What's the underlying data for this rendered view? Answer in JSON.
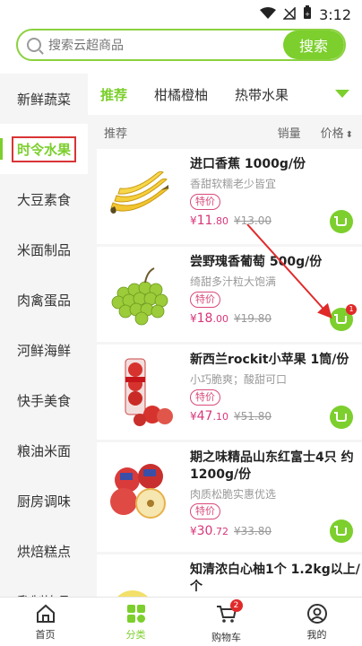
{
  "status_bar": {
    "time": "3:12"
  },
  "search": {
    "placeholder": "搜索云超商品",
    "button_label": "搜索"
  },
  "sidebar": {
    "items": [
      {
        "label": "新鲜蔬菜",
        "active": false
      },
      {
        "label": "时令水果",
        "active": true
      },
      {
        "label": "大豆素食",
        "active": false
      },
      {
        "label": "米面制品",
        "active": false
      },
      {
        "label": "肉禽蛋品",
        "active": false
      },
      {
        "label": "河鲜海鲜",
        "active": false
      },
      {
        "label": "快手美食",
        "active": false
      },
      {
        "label": "粮油米面",
        "active": false
      },
      {
        "label": "厨房调味",
        "active": false
      },
      {
        "label": "烘焙糕点",
        "active": false
      },
      {
        "label": "乳制饮品",
        "active": false
      }
    ]
  },
  "tabs": {
    "items": [
      "推荐",
      "柑橘橙柚",
      "热带水果"
    ],
    "active_index": 0
  },
  "sort": {
    "recommend": "推荐",
    "sales": "销量",
    "price": "价格",
    "price_arrows": "⬍"
  },
  "products": [
    {
      "name": "进口香蕉 1000g/份",
      "desc": "香甜软糯老少皆宜",
      "badge": "特价",
      "currency": "¥",
      "price_int": "11",
      "price_dec": ".80",
      "old_price": "¥13.00",
      "cart_count": ""
    },
    {
      "name": "尝野瑰香葡萄 500g/份",
      "desc": "绮甜多汁粒大饱满",
      "badge": "特价",
      "currency": "¥",
      "price_int": "18",
      "price_dec": ".00",
      "old_price": "¥19.80",
      "cart_count": "1"
    },
    {
      "name": "新西兰rockit小苹果 1筒/份",
      "desc": "小巧脆爽；酸甜可口",
      "badge": "特价",
      "currency": "¥",
      "price_int": "47",
      "price_dec": ".10",
      "old_price": "¥51.80",
      "cart_count": ""
    },
    {
      "name": "期之味精品山东红富士4只 约1200g/份",
      "desc": "肉质松脆实惠优选",
      "badge": "特价",
      "currency": "¥",
      "price_int": "30",
      "price_dec": ".72",
      "old_price": "¥33.80",
      "cart_count": ""
    },
    {
      "name": "知清浓白心柚1个 1.2kg以上/个",
      "desc": "",
      "badge": "",
      "currency": "",
      "price_int": "",
      "price_dec": "",
      "old_price": "",
      "cart_count": ""
    }
  ],
  "tabbar": {
    "items": [
      {
        "label": "首页",
        "active": false
      },
      {
        "label": "分类",
        "active": true
      },
      {
        "label": "购物车",
        "active": false,
        "badge": "2"
      },
      {
        "label": "我的",
        "active": false
      }
    ]
  },
  "colors": {
    "accent": "#7ccf2d",
    "price": "#d8367a",
    "badge_red": "#e02a2a",
    "highlight_box": "#d83434"
  }
}
